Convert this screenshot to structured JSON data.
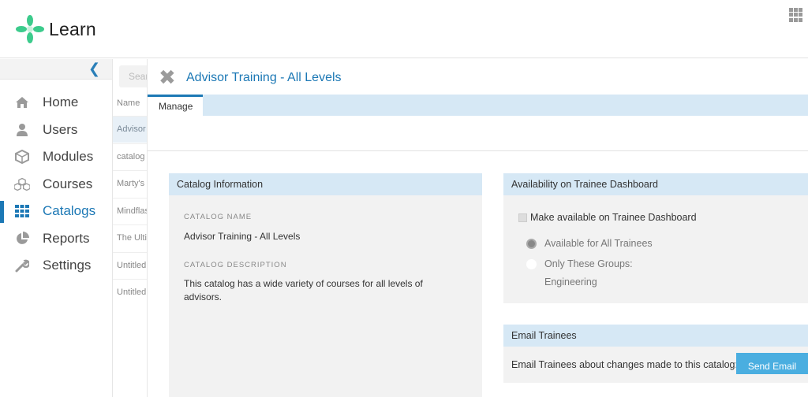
{
  "app": {
    "name": "Learn",
    "brand_color": "#3ccb8c",
    "accent_color": "#1c78b5"
  },
  "sidebar": {
    "collapse_icon": "chevron-left-icon",
    "items": [
      {
        "label": "Home",
        "icon": "home-icon",
        "active": false
      },
      {
        "label": "Users",
        "icon": "user-icon",
        "active": false
      },
      {
        "label": "Modules",
        "icon": "cube-icon",
        "active": false
      },
      {
        "label": "Courses",
        "icon": "cubes-icon",
        "active": false
      },
      {
        "label": "Catalogs",
        "icon": "grid-icon",
        "active": true
      },
      {
        "label": "Reports",
        "icon": "pie-chart-icon",
        "active": false
      },
      {
        "label": "Settings",
        "icon": "wrench-icon",
        "active": false
      }
    ]
  },
  "list": {
    "search_placeholder": "Search",
    "column_header": "Name",
    "rows": [
      "Advisor",
      "catalog",
      "Marty's",
      "Mindflash",
      "The Ulti",
      "Untitled",
      "Untitled"
    ]
  },
  "detail": {
    "title": "Advisor Training - All Levels",
    "tabs": [
      {
        "label": "Manage",
        "active": true
      }
    ],
    "catalog_info": {
      "heading": "Catalog Information",
      "name_label": "CATALOG NAME",
      "name_value": "Advisor Training - All Levels",
      "description_label": "CATALOG DESCRIPTION",
      "description_value": "This catalog has a wide variety of courses for all levels of advisors."
    },
    "availability": {
      "heading": "Availability on Trainee Dashboard",
      "checkbox_label": "Make available on Trainee Dashboard",
      "checkbox_checked": true,
      "options": [
        {
          "label": "Available for All Trainees",
          "selected": true
        },
        {
          "label": "Only These Groups:",
          "selected": false
        }
      ],
      "groups": "Engineering"
    },
    "email": {
      "heading": "Email Trainees",
      "text": "Email Trainees about changes made to this catalog:",
      "button_label": "Send Email"
    }
  }
}
